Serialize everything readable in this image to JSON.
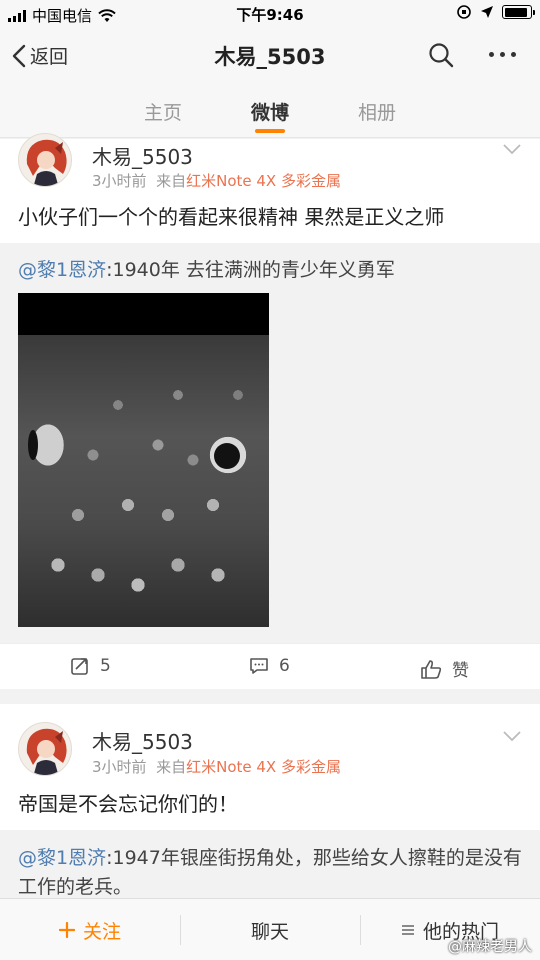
{
  "status_bar": {
    "carrier": "中国电信",
    "time": "下午9:46"
  },
  "nav": {
    "back_label": "返回",
    "title": "木易_5503"
  },
  "tabs": [
    {
      "label": "主页",
      "active": false
    },
    {
      "label": "微博",
      "active": true
    },
    {
      "label": "相册",
      "active": false
    }
  ],
  "posts": [
    {
      "author": "木易_5503",
      "time": "3小时前",
      "source_prefix": "来自",
      "device": "红米Note 4X 多彩金属",
      "text": "小伙子们一个个的看起来很精神 果然是正义之师",
      "repost": {
        "mention": "@黎1恩济",
        "text": ":1940年  去往满洲的青少年义勇军"
      },
      "actions": {
        "repost_count": "5",
        "comment_count": "6",
        "like_label": "赞"
      }
    },
    {
      "author": "木易_5503",
      "time": "3小时前",
      "source_prefix": "来自",
      "device": "红米Note 4X 多彩金属",
      "text": "帝国是不会忘记你们的！",
      "repost": {
        "mention": "@黎1恩济",
        "text": ":1947年银座街拐角处，那些给女人擦鞋的是没有工作的老兵。"
      }
    }
  ],
  "bottom_bar": {
    "follow_label": "关注",
    "chat_label": "聊天",
    "hot_label": "他的热门",
    "watermark": "@麻辣老男人"
  },
  "colors": {
    "accent": "#ff8200",
    "mention": "#507daf",
    "device": "#eb7350"
  }
}
